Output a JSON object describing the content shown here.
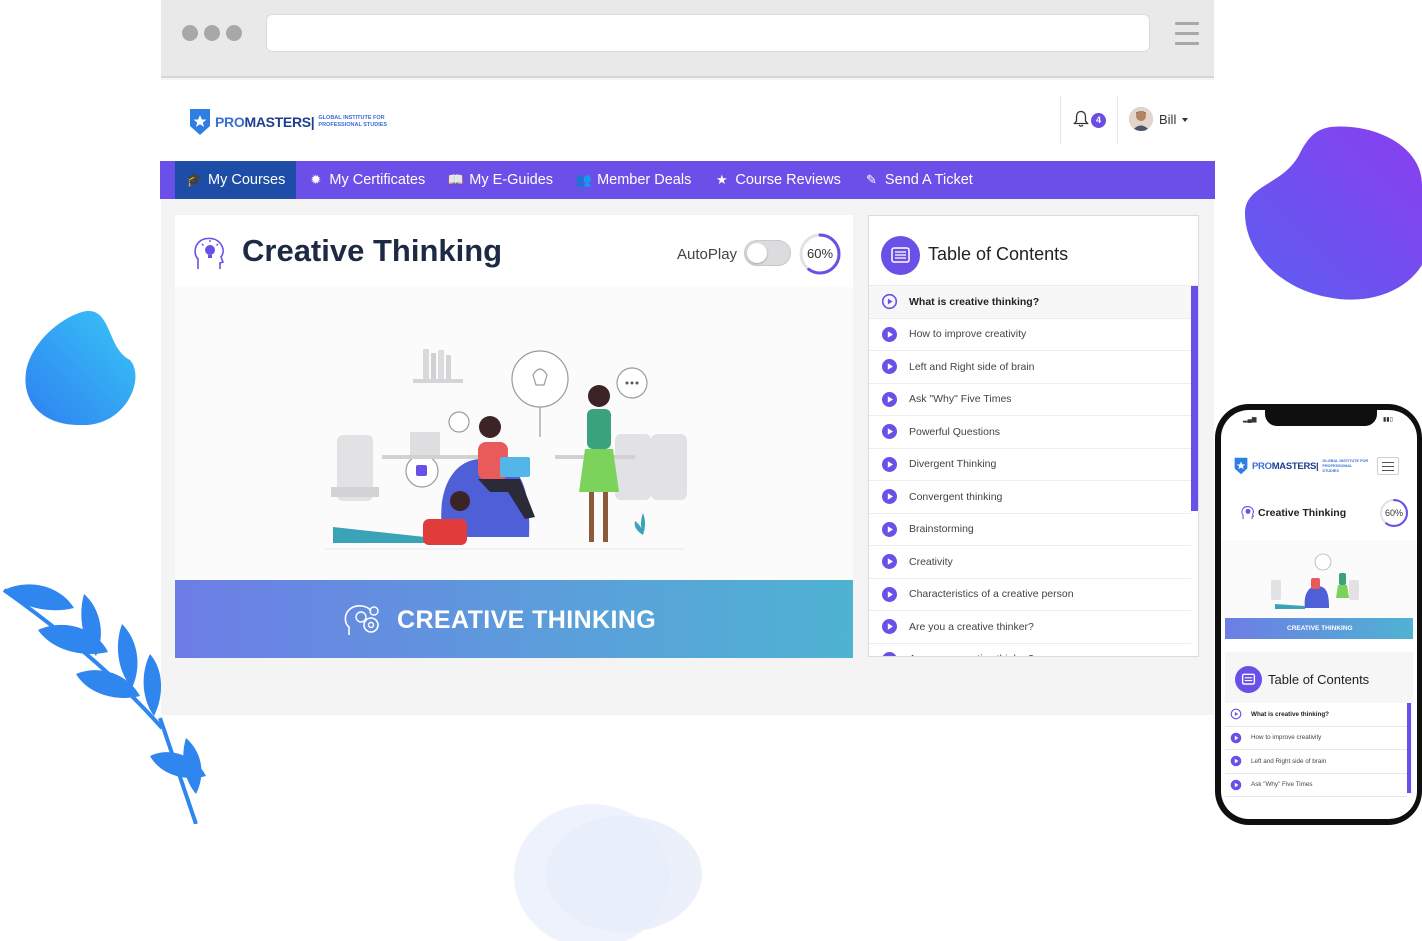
{
  "brand": {
    "name_light": "PRO",
    "name_bold": "MASTERS|",
    "tagline": "GLOBAL INSTITUTE FOR PROFESSIONAL STUDIES",
    "accent_color": "#6a4fe8",
    "nav_active_color": "#1d4da6"
  },
  "header": {
    "notification_count": "4",
    "user_name": "Bill"
  },
  "nav": {
    "items": [
      {
        "label": "My Courses",
        "icon": "graduation-cap-icon",
        "glyph": "🎓",
        "active": true
      },
      {
        "label": "My Certificates",
        "icon": "certificate-icon",
        "glyph": "✹",
        "active": false
      },
      {
        "label": "My E-Guides",
        "icon": "book-icon",
        "glyph": "📖",
        "active": false
      },
      {
        "label": "Member Deals",
        "icon": "users-icon",
        "glyph": "👥",
        "active": false
      },
      {
        "label": "Course Reviews",
        "icon": "star-icon",
        "glyph": "★",
        "active": false
      },
      {
        "label": "Send A Ticket",
        "icon": "edit-icon",
        "glyph": "✎",
        "active": false
      }
    ]
  },
  "course": {
    "title": "Creative Thinking",
    "autoplay_label": "AutoPlay",
    "autoplay_on": false,
    "progress_percent": 60,
    "progress_text": "60%",
    "banner_text": "CREATIVE THINKING"
  },
  "toc": {
    "title": "Table of Contents",
    "items": [
      "What is creative thinking?",
      "How to improve creativity",
      "Left and Right side of brain",
      "Ask \"Why\" Five Times",
      "Powerful Questions",
      "Divergent Thinking",
      "Convergent thinking",
      "Brainstorming",
      "Creativity",
      "Characteristics of a creative person",
      "Are you a creative thinker?",
      "Are you a creative thinker?"
    ],
    "current_index": 0
  },
  "mobile": {
    "title": "Creative Thinking",
    "progress_text": "60%",
    "banner_text": "CREATIVE THINKING",
    "toc_title": "Table of Contents",
    "toc_items": [
      "What is creative thinking?",
      "How to improve creativity",
      "Left and Right side of brain",
      "Ask \"Why\" Five Times"
    ]
  }
}
